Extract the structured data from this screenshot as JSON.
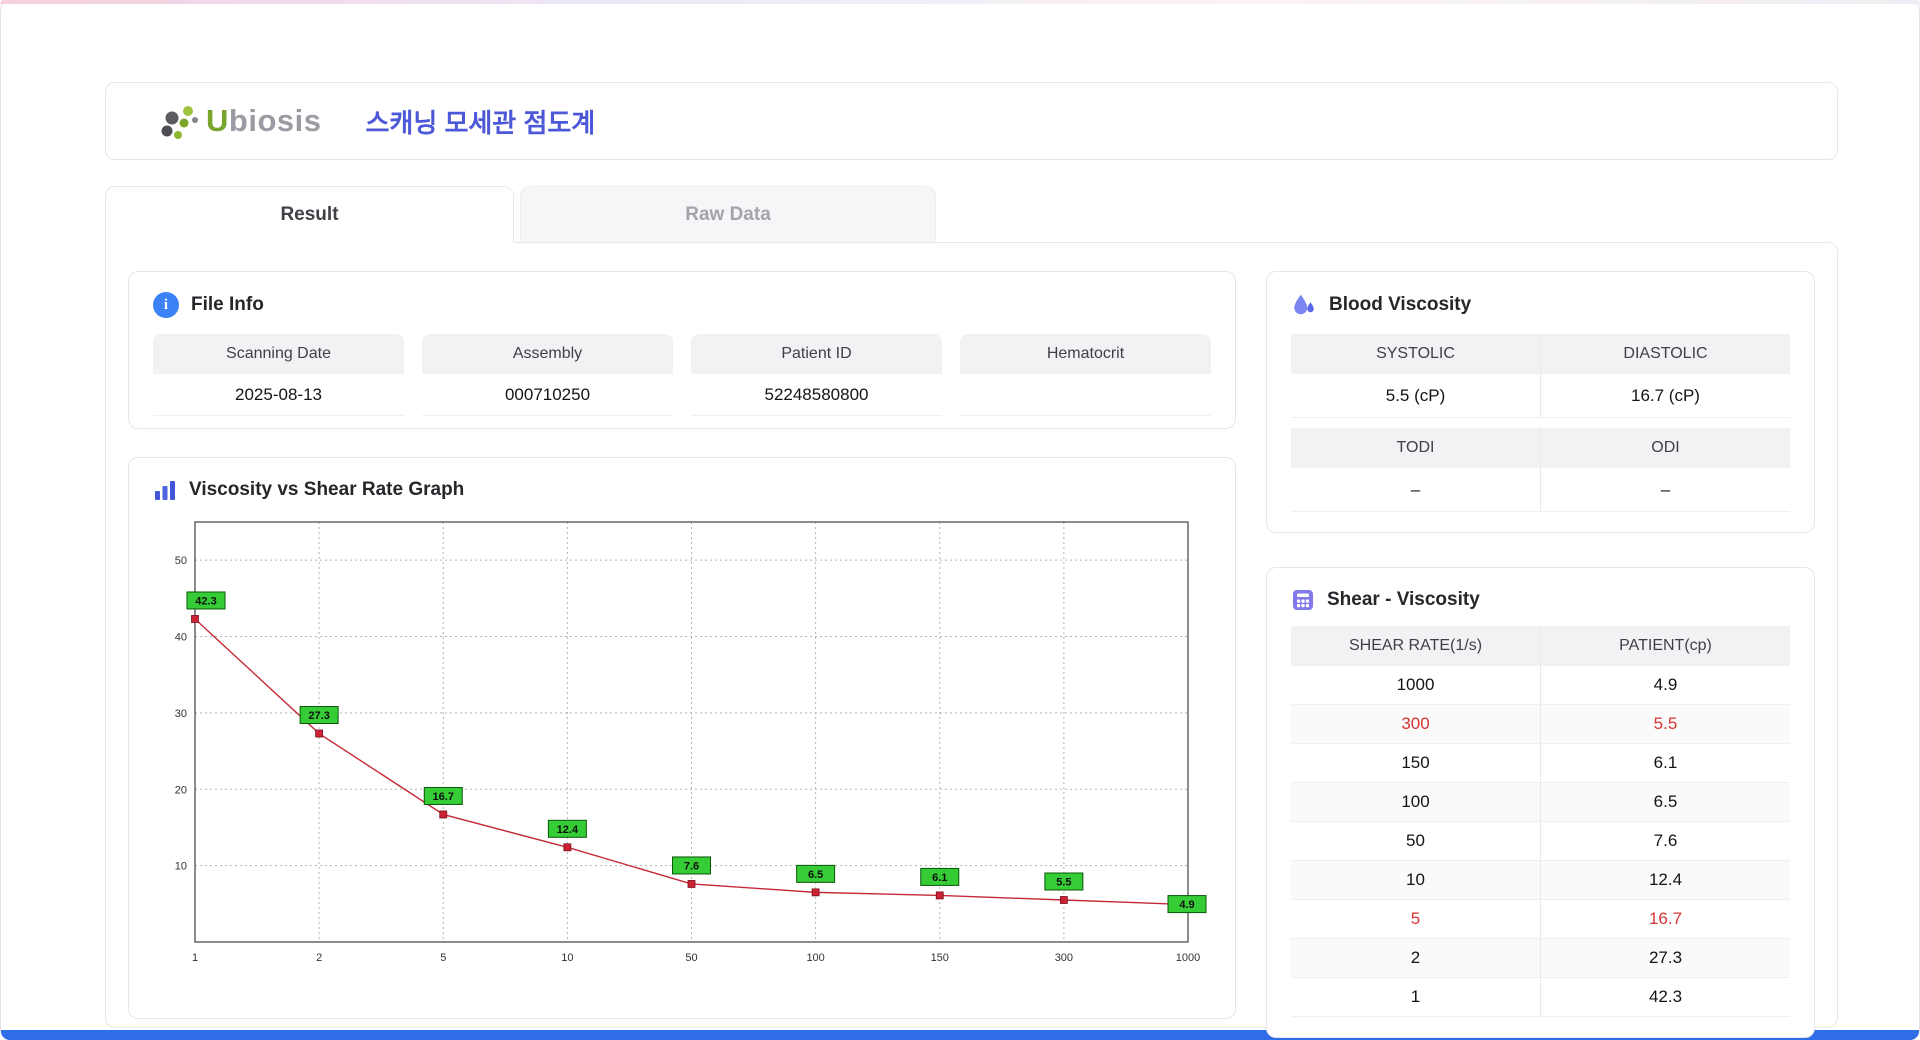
{
  "header": {
    "brand_u": "U",
    "brand_rest": "biosis",
    "title": "스캐닝 모세관 점도계"
  },
  "tabs": [
    {
      "label": "Result",
      "active": true
    },
    {
      "label": "Raw Data",
      "active": false
    }
  ],
  "file_info": {
    "title": "File Info",
    "fields": [
      {
        "label": "Scanning Date",
        "value": "2025-08-13"
      },
      {
        "label": "Assembly",
        "value": "000710250"
      },
      {
        "label": "Patient ID",
        "value": "52248580800"
      },
      {
        "label": "Hematocrit",
        "value": ""
      }
    ]
  },
  "graph": {
    "title": "Viscosity vs Shear Rate Graph"
  },
  "chart_data": {
    "type": "line",
    "x": [
      1,
      2,
      5,
      10,
      50,
      100,
      150,
      300,
      1000
    ],
    "values": [
      42.3,
      27.3,
      16.7,
      12.4,
      7.6,
      6.5,
      6.1,
      5.5,
      4.9
    ],
    "title": "Viscosity vs Shear Rate Graph",
    "xlabel": "",
    "ylabel": "",
    "x_scale": "category",
    "yticks": [
      10,
      20,
      30,
      40,
      50
    ],
    "ylim": [
      0,
      55
    ],
    "grid": true,
    "line_color": "#c62a38",
    "marker_color": "#cc2233",
    "label_bg": "#35cc35",
    "label_border": "#0a570a"
  },
  "blood_viscosity": {
    "title": "Blood Viscosity",
    "systolic_label": "SYSTOLIC",
    "diastolic_label": "DIASTOLIC",
    "systolic_value": "5.5 (cP)",
    "diastolic_value": "16.7 (cP)",
    "todi_label": "TODI",
    "odi_label": "ODI",
    "todi_value": "–",
    "odi_value": "–"
  },
  "shear_table": {
    "title": "Shear - Viscosity",
    "columns": [
      "SHEAR RATE(1/s)",
      "PATIENT(cp)"
    ],
    "rows": [
      {
        "rate": "1000",
        "patient": "4.9",
        "highlight": false
      },
      {
        "rate": "300",
        "patient": "5.5",
        "highlight": true
      },
      {
        "rate": "150",
        "patient": "6.1",
        "highlight": false
      },
      {
        "rate": "100",
        "patient": "6.5",
        "highlight": false
      },
      {
        "rate": "50",
        "patient": "7.6",
        "highlight": false
      },
      {
        "rate": "10",
        "patient": "12.4",
        "highlight": false
      },
      {
        "rate": "5",
        "patient": "16.7",
        "highlight": true
      },
      {
        "rate": "2",
        "patient": "27.3",
        "highlight": false
      },
      {
        "rate": "1",
        "patient": "42.3",
        "highlight": false
      }
    ]
  }
}
